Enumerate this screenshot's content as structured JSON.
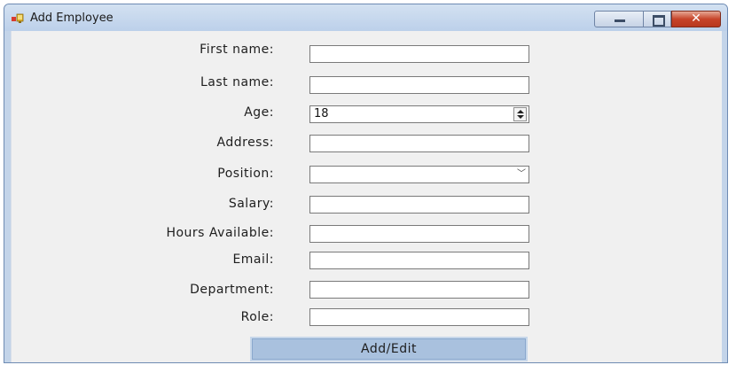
{
  "window": {
    "title": "Add Employee",
    "close_glyph": "✕"
  },
  "form": {
    "fields": [
      {
        "label": "First name:",
        "value": "",
        "type": "text"
      },
      {
        "label": "Last name:",
        "value": "",
        "type": "text"
      },
      {
        "label": "Age:",
        "value": "18",
        "type": "numeric"
      },
      {
        "label": "Address:",
        "value": "",
        "type": "text"
      },
      {
        "label": "Position:",
        "value": "",
        "type": "combobox",
        "arrow_glyph": "﹀"
      },
      {
        "label": "Salary:",
        "value": "",
        "type": "text"
      },
      {
        "label": "Hours Available:",
        "value": "",
        "type": "text"
      },
      {
        "label": "Email:",
        "value": "",
        "type": "text"
      },
      {
        "label": "Department:",
        "value": "",
        "type": "text"
      },
      {
        "label": "Role:",
        "value": "",
        "type": "text"
      }
    ],
    "submit_label": "Add/Edit"
  },
  "colors": {
    "titlebar": "#c3d4e9",
    "client_background": "#f0f0f0",
    "close_button": "#c7442a",
    "submit_button": "#a9c1de"
  }
}
